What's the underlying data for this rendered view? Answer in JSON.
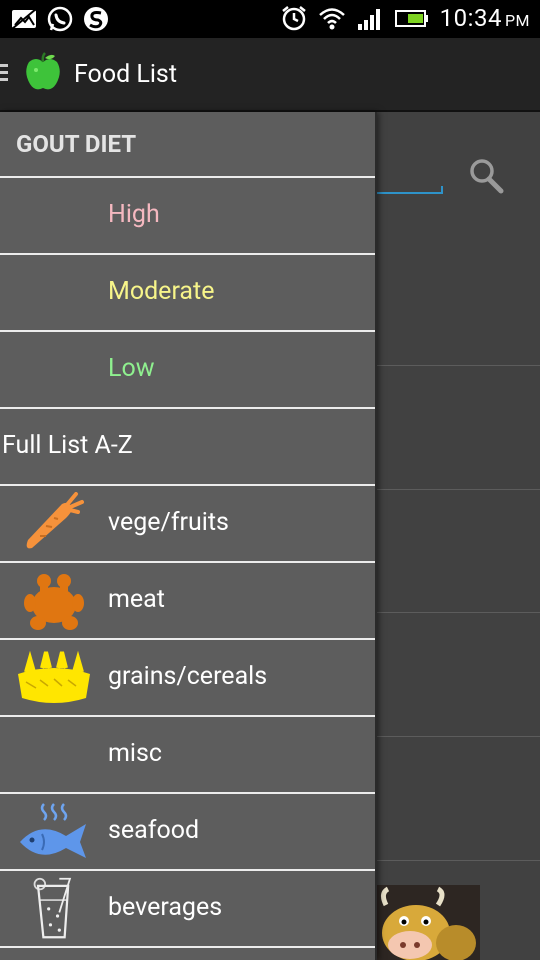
{
  "status_bar": {
    "time": "10:34",
    "ampm": "PM",
    "left_icons": [
      "picture-icon",
      "whatsapp-icon",
      "app-s-icon"
    ],
    "right_icons": [
      "alarm-icon",
      "wifi-icon",
      "signal-icon",
      "battery-icon"
    ]
  },
  "action_bar": {
    "title": "Food List",
    "icon": "apple-icon"
  },
  "drawer": {
    "header": "GOUT DIET",
    "items": [
      {
        "label": "High",
        "color": "#f5b8c0",
        "icon": null
      },
      {
        "label": "Moderate",
        "color": "#f7f58a",
        "icon": null
      },
      {
        "label": "Low",
        "color": "#8ff08f",
        "icon": null
      },
      {
        "label": "Full List A-Z",
        "color": "#ffffff",
        "icon": null
      },
      {
        "label": "vege/fruits",
        "color": "#ffffff",
        "icon": "carrot-icon"
      },
      {
        "label": "meat",
        "color": "#ffffff",
        "icon": "roast-chicken-icon"
      },
      {
        "label": "grains/cereals",
        "color": "#ffffff",
        "icon": "wheat-icon"
      },
      {
        "label": "misc",
        "color": "#ffffff",
        "icon": null
      },
      {
        "label": "seafood",
        "color": "#ffffff",
        "icon": "fish-icon"
      },
      {
        "label": "beverages",
        "color": "#ffffff",
        "icon": "drink-glass-icon"
      }
    ]
  },
  "colors": {
    "accent": "#2e93c9",
    "drawer_bg": "#5d5d5d",
    "action_bar_bg": "#232323"
  }
}
